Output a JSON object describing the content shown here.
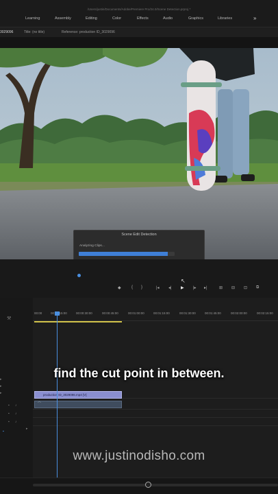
{
  "window_path": "/Users/justin/Documents/Adobe/Premiere Pro/24.0/Scene Detection.prproj *",
  "workspaces": [
    "Learning",
    "Assembly",
    "Editing",
    "Color",
    "Effects",
    "Audio",
    "Graphics",
    "Libraries"
  ],
  "workspaces_more": "»",
  "monitor_tabs": {
    "sequence": "3029096",
    "title": "Title: (no title)",
    "reference": "Reference: production ID_3029096"
  },
  "dialog": {
    "title": "Scene Edit Detection",
    "status": "Analyzing Clips...",
    "progress": 0.93,
    "cancel": "Cancel"
  },
  "transport": {
    "mark_in": "◆",
    "mark_out": "{",
    "go_in": "}",
    "step_back": "|◂",
    "step_back2": "◂|",
    "play": "▶",
    "step_fwd": "|▸",
    "go_out": "▸|",
    "lift": "⊞",
    "extract": "⊟",
    "camera": "⊡",
    "compare": "⧉"
  },
  "timeline": {
    "timecodes": [
      "00:00",
      "00:00:15:00",
      "00:00:30:00",
      "00:00:45:00",
      "00:01:00:00",
      "00:01:15:00",
      "00:01:30:00",
      "00:01:45:00",
      "00:02:00:00",
      "00:02:15:00"
    ],
    "video_clip": "production ID_3029096.mp4 [V]",
    "audio_clip": "⌒"
  },
  "caption": "find the cut point in between.",
  "watermark": "www.justinodisho.com",
  "colors": {
    "progress": "#3f7fd6",
    "playhead": "#4a8fe0",
    "video_clip": "#8a8fd0",
    "work_area": "#d2c34a"
  }
}
